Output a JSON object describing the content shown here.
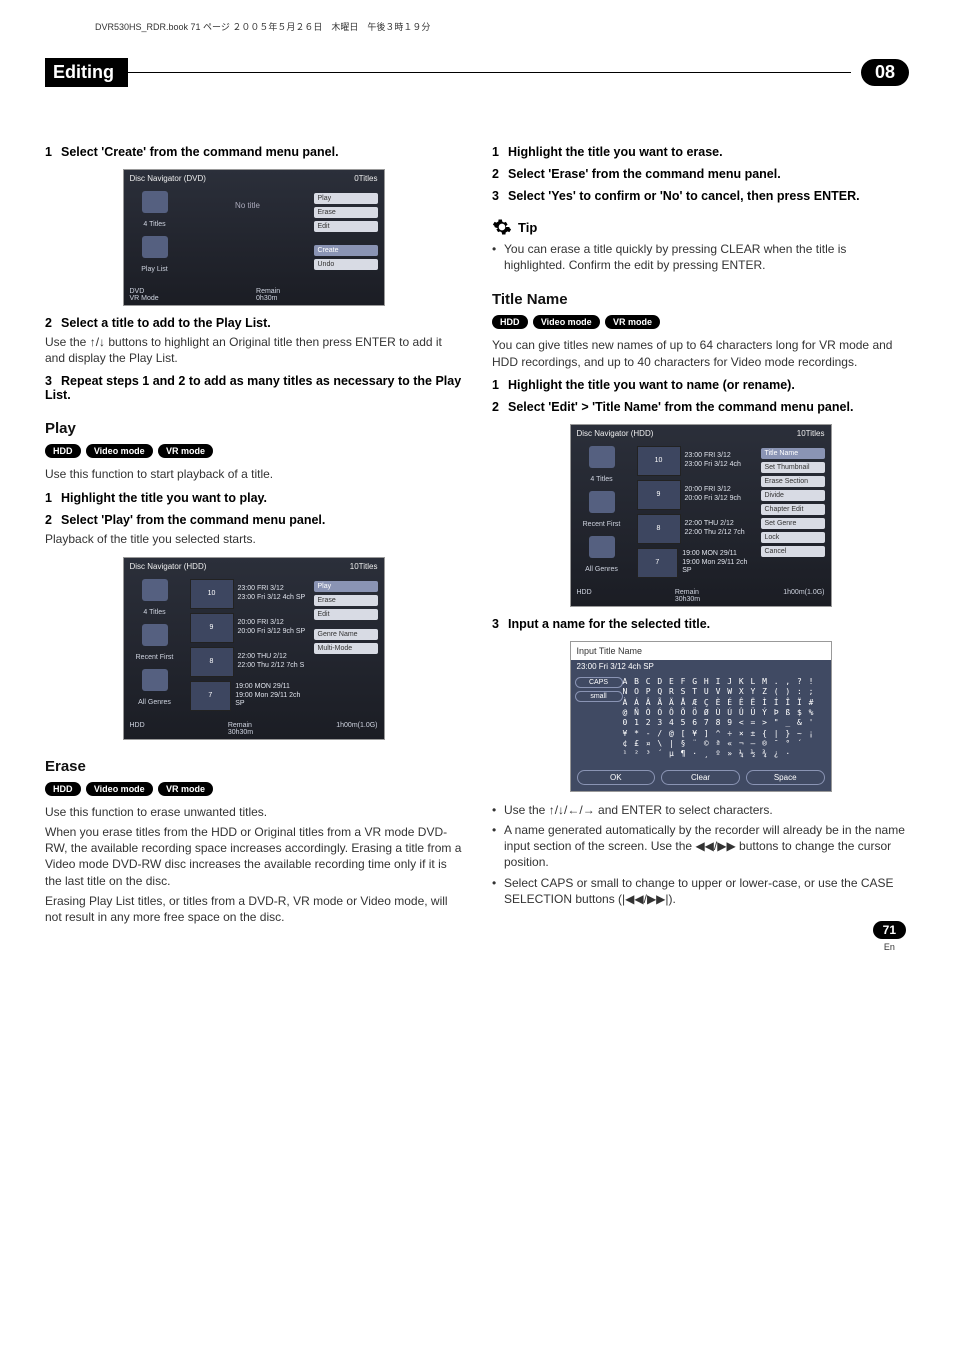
{
  "header": {
    "book_info": "DVR530HS_RDR.book  71 ページ  ２００５年５月２６日　木曜日　午後３時１９分"
  },
  "section": {
    "title": "Editing",
    "chapter": "08"
  },
  "left": {
    "step1": "Select 'Create' from the command menu panel.",
    "screenshot1": {
      "title": "Disc Navigator (DVD)",
      "count": "0Titles",
      "side": [
        "4 Titles",
        "Play List"
      ],
      "main_label": "No title",
      "menu": [
        "Play",
        "Erase",
        "Edit",
        "Create",
        "Undo"
      ],
      "foot_mode": "DVD\nVR Mode",
      "foot_remain": "Remain\n0h30m"
    },
    "step2_title": "Select a title to add to the Play List.",
    "step2_body": "Use the ↑/↓ buttons to highlight an Original title then press ENTER to add it and display the Play List.",
    "step3": "Repeat steps 1 and 2 to add as many titles as necessary to the Play List.",
    "play_heading": "Play",
    "play_badges": [
      "HDD",
      "Video mode",
      "VR mode"
    ],
    "play_body": "Use this function to start playback of a title.",
    "play_step1": "Highlight the title you want to play.",
    "play_step2": "Select 'Play' from the command menu panel.",
    "play_step2_body": "Playback of the title you selected starts.",
    "screenshot2": {
      "title": "Disc Navigator (HDD)",
      "count": "10Titles",
      "side": [
        "4 Titles",
        "Recent First",
        "All Genres"
      ],
      "rows": [
        {
          "n": "10",
          "l1": "23:00 FRI 3/12",
          "l2": "23:00 Fri 3/12 4ch SP"
        },
        {
          "n": "9",
          "l1": "20:00 FRI 3/12",
          "l2": "20:00 Fri 3/12 9ch SP"
        },
        {
          "n": "8",
          "l1": "22:00 THU 2/12",
          "l2": "22:00 Thu 2/12 7ch S"
        },
        {
          "n": "7",
          "l1": "19:00 MON 29/11",
          "l2": "19:00 Mon 29/11 2ch SP"
        }
      ],
      "menu": [
        "Play",
        "Erase",
        "Edit",
        "Genre Name",
        "Multi-Mode"
      ],
      "foot_mode": "HDD",
      "foot_remain": "Remain\n30h30m",
      "foot_right": "1h00m(1.0G)"
    },
    "erase_heading": "Erase",
    "erase_badges": [
      "HDD",
      "Video mode",
      "VR mode"
    ],
    "erase_body1": "Use this function to erase unwanted titles.",
    "erase_body2": "When you erase titles from the HDD or Original titles from a VR mode DVD-RW, the available recording space increases accordingly. Erasing a title from a Video mode DVD-RW disc increases the available recording time only if it is the last title on the disc.",
    "erase_body3": "Erasing Play List titles, or titles from a DVD-R, VR mode or Video mode, will not result in any more free space on the disc."
  },
  "right": {
    "step1": "Highlight the title you want to erase.",
    "step2": "Select 'Erase' from the command menu panel.",
    "step3": "Select 'Yes' to confirm or 'No' to cancel, then press ENTER.",
    "tip_label": "Tip",
    "tip_body": "You can erase a title quickly by pressing CLEAR when the title is highlighted. Confirm the edit by pressing ENTER.",
    "titlename_heading": "Title Name",
    "titlename_badges": [
      "HDD",
      "Video mode",
      "VR mode"
    ],
    "titlename_body": "You can give titles new names of up to 64 characters long for VR mode and HDD recordings, and up to 40 characters for Video mode recordings.",
    "tn_step1": "Highlight the title you want to name (or rename).",
    "tn_step2": "Select 'Edit' > 'Title Name' from the command menu panel.",
    "screenshot3": {
      "title": "Disc Navigator (HDD)",
      "count": "10Titles",
      "side": [
        "4 Titles",
        "Recent First",
        "All Genres"
      ],
      "rows": [
        {
          "n": "10",
          "l1": "23:00 FRI 3/12",
          "l2": "23:00 Fri 3/12 4ch"
        },
        {
          "n": "9",
          "l1": "20:00 FRI 3/12",
          "l2": "20:00 Fri 3/12 9ch"
        },
        {
          "n": "8",
          "l1": "22:00 THU 2/12",
          "l2": "22:00 Thu 2/12 7ch"
        },
        {
          "n": "7",
          "l1": "19:00 MON 29/11",
          "l2": "19:00 Mon 29/11 2ch SP"
        }
      ],
      "menu": [
        "Title Name",
        "Set Thumbnail",
        "Erase Section",
        "Divide",
        "Chapter Edit",
        "Set Genre",
        "Lock",
        "Cancel"
      ],
      "foot_mode": "HDD",
      "foot_remain": "Remain\n30h30m",
      "foot_right": "1h00m(1.0G)"
    },
    "tn_step3": "Input a name for the selected title.",
    "kbd": {
      "head": "Input Title Name",
      "title": "23:00 Fri 3/12 4ch SP",
      "side": [
        "CAPS",
        "small"
      ],
      "rows": [
        "A B C D E F G H I J K L M . , ? !",
        "N O P Q R S T U V W X Y Z ( ) : ;",
        "À Á Â Ã Ä Å Æ Ç È É Ê Ë Ì Í Î Ï #",
        "@ Ñ Ò Ó Ô Õ Ö Ø Ù Ú Û Ü Ý Þ ß $ %",
        "0 1 2 3 4 5 6 7 8 9 < = > \" _ & '",
        "¥ * - / @ [ ¥ ] ^ ÷ × ± { | } ~ ¡",
        "¢ £ ¤ \\ | § ¨ © ª « ¬ – ® ¯ ° ´",
        "¹ ² ³ ´ µ ¶ · ¸ º » ¼ ½ ¾ ¿ ·"
      ],
      "buttons": [
        "OK",
        "Clear",
        "Space"
      ]
    },
    "bullets": [
      "Use the ↑/↓/←/→ and ENTER to select characters.",
      "A name generated automatically by the recorder will already be in the name input section of the screen. Use the ◀◀/▶▶ buttons to change the cursor position.",
      "Select CAPS or small to change to upper or lower-case, or use the CASE SELECTION buttons (|◀◀/▶▶|)."
    ]
  },
  "page": {
    "number": "71",
    "lang": "En"
  }
}
